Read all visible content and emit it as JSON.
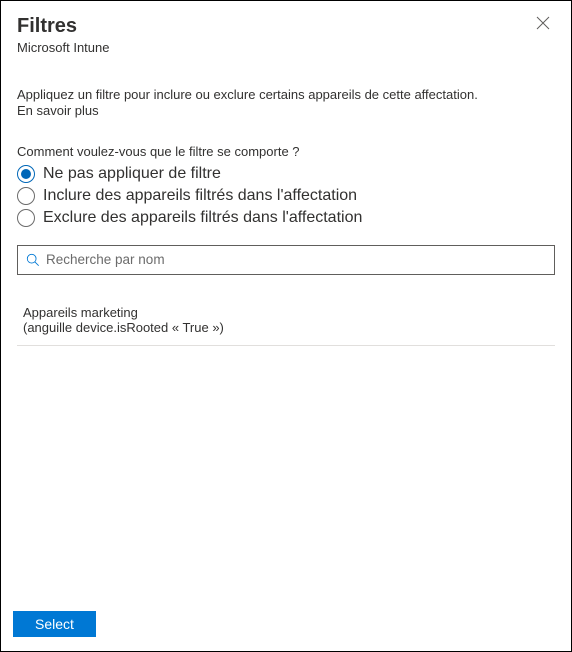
{
  "header": {
    "title": "Filtres",
    "subtitle": "Microsoft Intune"
  },
  "description": {
    "text": "Appliquez un filtre pour inclure ou exclure certains appareils de cette affectation.",
    "learn_more": "En savoir plus"
  },
  "question": "Comment voulez-vous que le filtre se comporte ?",
  "options": [
    {
      "label": "Ne pas appliquer de filtre",
      "selected": true
    },
    {
      "label": "Inclure des appareils filtrés dans l'affectation",
      "selected": false
    },
    {
      "label": "Exclure des appareils filtrés dans l'affectation",
      "selected": false
    }
  ],
  "search": {
    "placeholder": "Recherche par nom",
    "value": ""
  },
  "items": [
    {
      "name": "Appareils marketing",
      "detail": "(anguille device.isRooted « True »)"
    }
  ],
  "footer": {
    "select_label": "Select"
  }
}
